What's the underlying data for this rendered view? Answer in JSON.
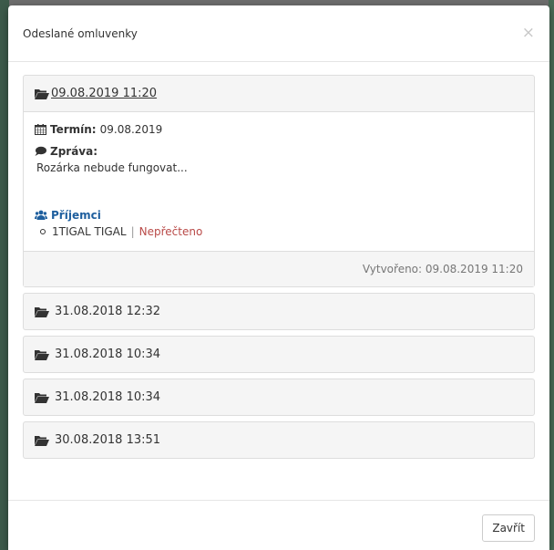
{
  "modal": {
    "title": "Odeslané omluvenky",
    "close_symbol": "×",
    "close_button": "Zavřít"
  },
  "entries": [
    {
      "heading": " 09.08.2019 11:20",
      "expanded": true,
      "term_label": "Termín:",
      "term_value": "09.08.2019",
      "message_label": "Zpráva:",
      "message": "Rozárka nebude fungovat...",
      "recipients_label": "Příjemci",
      "recipients": [
        {
          "name": "1TIGAL TIGAL",
          "separator": "|",
          "status": "Nepřečteno"
        }
      ],
      "created": "Vytvořeno: 09.08.2019 11:20"
    },
    {
      "heading": "31.08.2018 12:32",
      "expanded": false
    },
    {
      "heading": "31.08.2018 10:34",
      "expanded": false
    },
    {
      "heading": "31.08.2018 10:34",
      "expanded": false
    },
    {
      "heading": "30.08.2018 13:51",
      "expanded": false
    }
  ],
  "icons": {
    "folder": "folder-open-icon",
    "calendar": "calendar-icon",
    "comment": "comment-icon",
    "users": "users-icon"
  },
  "colors": {
    "link_blue": "#1f5f9e",
    "unread_red": "#b94a48",
    "panel_bg": "#f5f5f5"
  }
}
